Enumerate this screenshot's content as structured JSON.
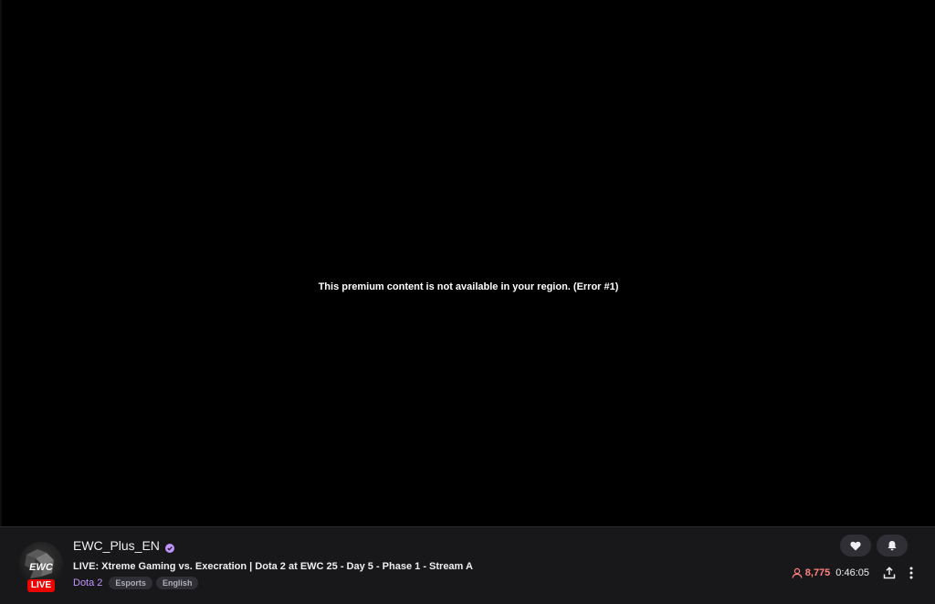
{
  "player": {
    "error_message": "This premium content is not available in your region. (Error #1)"
  },
  "channel": {
    "name": "EWC_Plus_EN",
    "avatar_text": "EWC",
    "live_label": "LIVE",
    "verified_icon": "verified-badge-icon"
  },
  "stream": {
    "title": "LIVE: Xtreme Gaming vs. Execration | Dota 2 at EWC 25 - Day 5 - Phase 1 - Stream A",
    "game": "Dota 2",
    "tags": [
      "Esports",
      "English"
    ]
  },
  "stats": {
    "viewer_count": "8,775",
    "uptime": "0:46:05"
  },
  "colors": {
    "accent": "#bf94ff",
    "live": "#eb0400",
    "viewers": "#ff8280"
  }
}
